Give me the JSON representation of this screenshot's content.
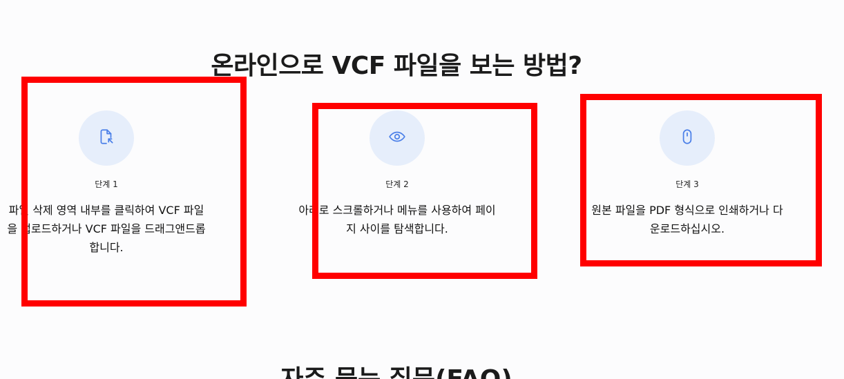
{
  "how_to": {
    "title": "온라인으로 VCF 파일을 보는 방법?",
    "steps": [
      {
        "icon": "file-click-icon",
        "label": "단계 1",
        "description": "파일 삭제 영역 내부를 클릭하여 VCF 파일을 업로드하거나 VCF 파일을 드래그앤드롭합니다."
      },
      {
        "icon": "eye-icon",
        "label": "단계 2",
        "description": "아래로 스크롤하거나 메뉴를 사용하여 페이지 사이를 탐색합니다."
      },
      {
        "icon": "mouse-icon",
        "label": "단계 3",
        "description": "원본 파일을 PDF 형식으로 인쇄하거나 다운로드하십시오."
      }
    ]
  },
  "faq": {
    "title": "자주 묻는 질문(FAQ)"
  },
  "colors": {
    "icon_accent": "#4a7fe8",
    "icon_bg": "#e6eefb",
    "annotation": "#ff0000"
  }
}
